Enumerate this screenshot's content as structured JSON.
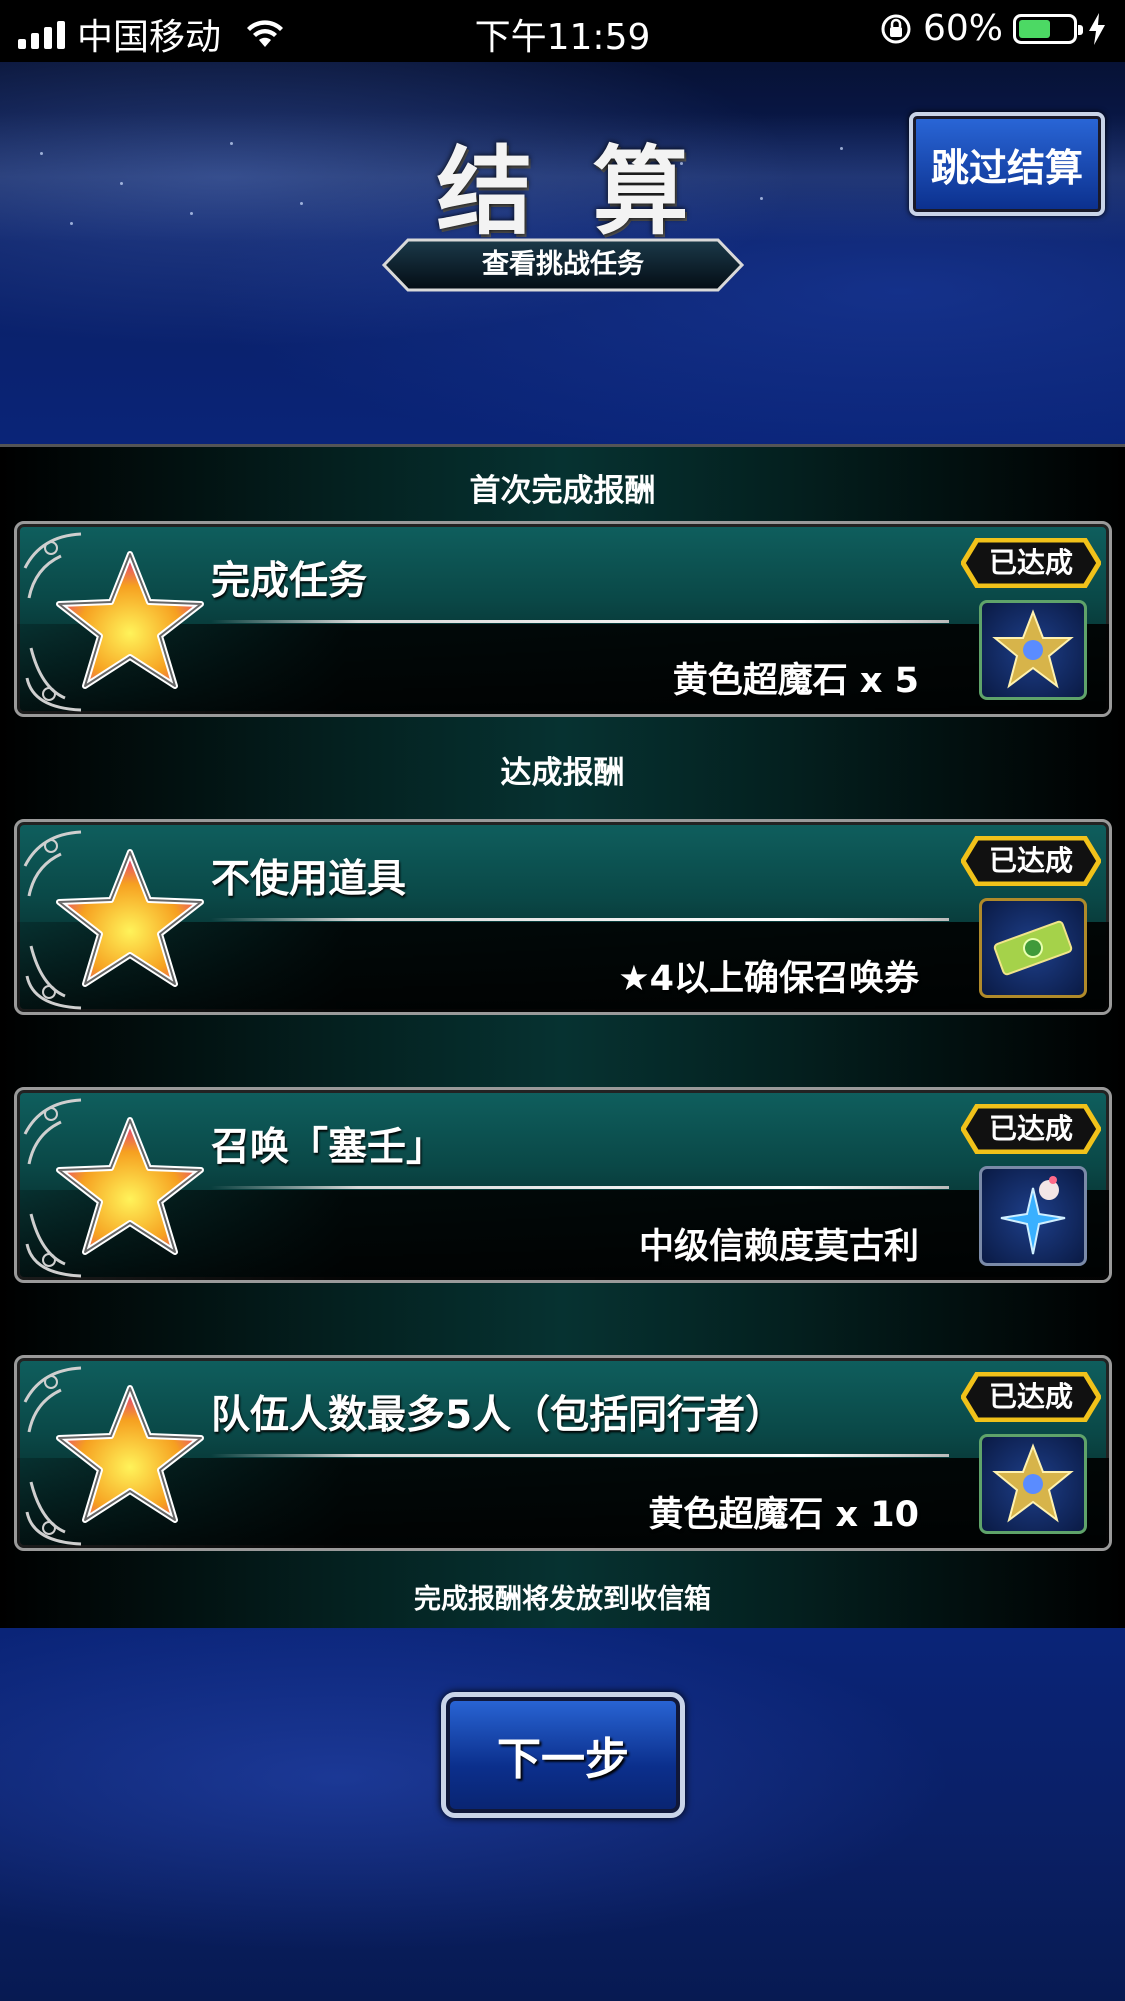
{
  "status_bar": {
    "carrier": "中国移动",
    "time": "下午11:59",
    "battery": "60%",
    "battery_level": 0.6
  },
  "header": {
    "title": "结算",
    "skip_button": "跳过结算",
    "view_tasks_button": "查看挑战任务"
  },
  "sections": {
    "first_clear": "首次完成报酬",
    "achievements": "达成报酬"
  },
  "missions": [
    {
      "name": "完成任务",
      "reward": "黄色超魔石 x 5",
      "status": "已达成",
      "reward_icon": "yellow-magicite-icon"
    },
    {
      "name": "不使用道具",
      "reward": "★4以上确保召唤券",
      "status": "已达成",
      "reward_icon": "summon-ticket-icon"
    },
    {
      "name": "召唤「塞壬」",
      "reward": "中级信赖度莫古利",
      "status": "已达成",
      "reward_icon": "trust-moogle-icon"
    },
    {
      "name": "队伍人数最多5人（包括同行者）",
      "reward": "黄色超魔石 x 10",
      "status": "已达成",
      "reward_icon": "yellow-magicite-icon"
    }
  ],
  "footer_note": "完成报酬将发放到收信箱",
  "next_button": "下一步"
}
